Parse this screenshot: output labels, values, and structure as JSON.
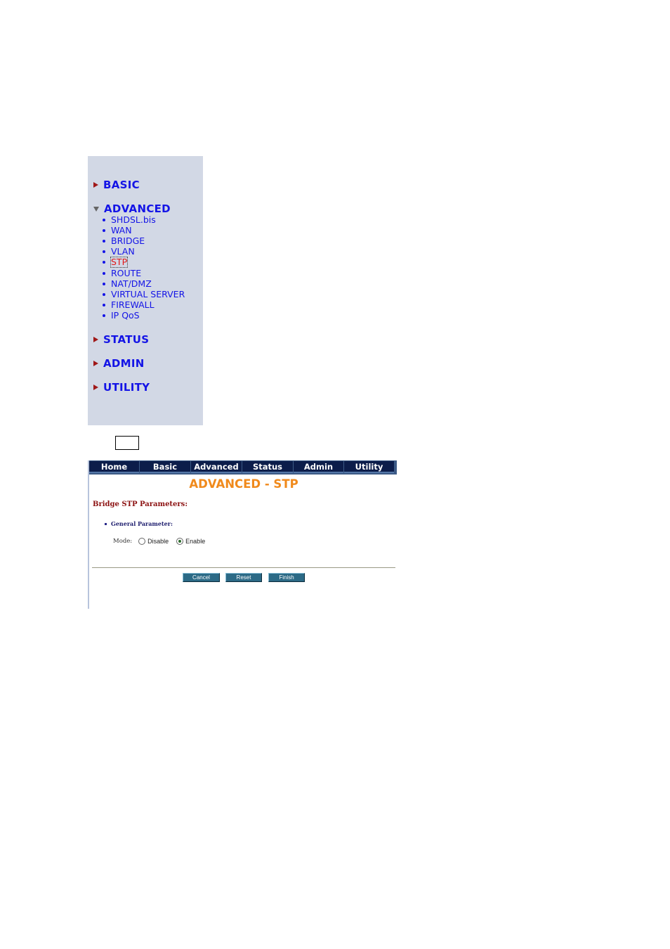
{
  "sidebar": {
    "sections": [
      {
        "label": "BASIC",
        "expanded": false
      },
      {
        "label": "ADVANCED",
        "expanded": true
      },
      {
        "label": "STATUS",
        "expanded": false
      },
      {
        "label": "ADMIN",
        "expanded": false
      },
      {
        "label": "UTILITY",
        "expanded": false
      }
    ],
    "advanced_items": [
      "SHDSL.bis",
      "WAN",
      "BRIDGE",
      "VLAN",
      "STP",
      "ROUTE",
      "NAT/DMZ",
      "VIRTUAL SERVER",
      "FIREWALL",
      "IP QoS"
    ],
    "active_item": "STP"
  },
  "navbar": {
    "tabs": [
      "Home",
      "Basic",
      "Advanced",
      "Status",
      "Admin",
      "Utility"
    ]
  },
  "main": {
    "title": "ADVANCED - STP",
    "heading": "Bridge STP Parameters:",
    "general_parameter": "General Parameter:",
    "mode_label": "Mode:",
    "mode_options": [
      "Disable",
      "Enable"
    ],
    "mode_selected": "Enable"
  },
  "actions": {
    "cancel": "Cancel",
    "reset": "Reset",
    "finish": "Finish"
  },
  "colors": {
    "sidebar_bg": "#d2d8e5",
    "link": "#1414e6",
    "title": "#f08a1c",
    "heading": "#8b1010",
    "nav_button": "#0c1d4a",
    "action_button": "#2c6a86"
  }
}
